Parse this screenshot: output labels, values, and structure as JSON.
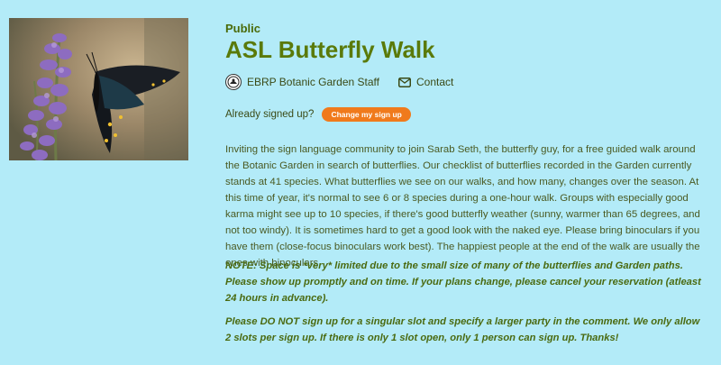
{
  "event": {
    "visibility": "Public",
    "title": "ASL Butterfly Walk",
    "organizer": "EBRP Botanic Garden Staff",
    "contact_label": "Contact",
    "signup_status": "Already signed up?",
    "change_signup_label": "Change my sign up",
    "description": "Inviting the sign language community to join Sarab Seth, the butterfly guy, for a free guided walk around the Botanic Garden in search of butterflies. Our checklist of butterflies recorded in the Garden currently stands at 41 species. What butterflies we see on our walks, and how many, changes over the season. At this time of year, it's normal to see 6 or 8 species during a one-hour walk. Groups with especially good karma might see up to 10 species, if there's good butterfly weather (sunny, warmer than 65 degrees, and not too windy). It is sometimes hard to get a good look with the naked eye. Please bring binoculars if you have them (close-focus binoculars work best). The happiest people at the end of the walk are usually the ones with binoculars",
    "note_space": "NOTE: Space is *very* limited due to the small size of many of the butterflies and Garden paths. Please show up promptly and on time. If your plans change, please cancel your reservation (atleast 24 hours in advance).",
    "note_slots": "Please DO NOT sign up for a singular slot and specify a larger party in the comment. We only allow 2 slots per sign up. If there is only 1 slot open, only 1 person can sign up. Thanks!"
  },
  "icons": {
    "avatar": "organizer-avatar",
    "contact": "envelope-icon"
  },
  "colors": {
    "background": "#b3ebf8",
    "title": "#5a7a0a",
    "button": "#f07a1c"
  }
}
